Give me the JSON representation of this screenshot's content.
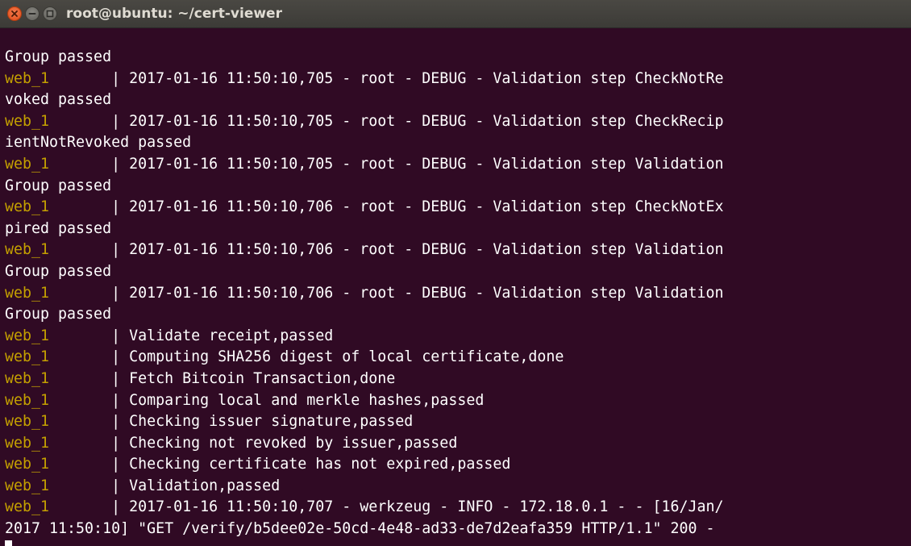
{
  "window": {
    "title": "root@ubuntu: ~/cert-viewer"
  },
  "colors": {
    "background": "#300a24",
    "text": "#ffffff",
    "container_prefix": "#c4a000",
    "close_button": "#df4a16"
  },
  "terminal": {
    "prefix": "web_1       ",
    "lines": [
      {
        "p": false,
        "t": "Group passed"
      },
      {
        "p": true,
        "t": "| 2017-01-16 11:50:10,705 - root - DEBUG - Validation step CheckNotRe"
      },
      {
        "p": false,
        "t": "voked passed"
      },
      {
        "p": true,
        "t": "| 2017-01-16 11:50:10,705 - root - DEBUG - Validation step CheckRecip"
      },
      {
        "p": false,
        "t": "ientNotRevoked passed"
      },
      {
        "p": true,
        "t": "| 2017-01-16 11:50:10,705 - root - DEBUG - Validation step Validation"
      },
      {
        "p": false,
        "t": "Group passed"
      },
      {
        "p": true,
        "t": "| 2017-01-16 11:50:10,706 - root - DEBUG - Validation step CheckNotEx"
      },
      {
        "p": false,
        "t": "pired passed"
      },
      {
        "p": true,
        "t": "| 2017-01-16 11:50:10,706 - root - DEBUG - Validation step Validation"
      },
      {
        "p": false,
        "t": "Group passed"
      },
      {
        "p": true,
        "t": "| 2017-01-16 11:50:10,706 - root - DEBUG - Validation step Validation"
      },
      {
        "p": false,
        "t": "Group passed"
      },
      {
        "p": true,
        "t": "| Validate receipt,passed"
      },
      {
        "p": true,
        "t": "| Computing SHA256 digest of local certificate,done"
      },
      {
        "p": true,
        "t": "| Fetch Bitcoin Transaction,done"
      },
      {
        "p": true,
        "t": "| Comparing local and merkle hashes,passed"
      },
      {
        "p": true,
        "t": "| Checking issuer signature,passed"
      },
      {
        "p": true,
        "t": "| Checking not revoked by issuer,passed"
      },
      {
        "p": true,
        "t": "| Checking certificate has not expired,passed"
      },
      {
        "p": true,
        "t": "| Validation,passed"
      },
      {
        "p": true,
        "t": "| 2017-01-16 11:50:10,707 - werkzeug - INFO - 172.18.0.1 - - [16/Jan/"
      },
      {
        "p": false,
        "t": "2017 11:50:10] \"GET /verify/b5dee02e-50cd-4e48-ad33-de7d2eafa359 HTTP/1.1\" 200 -"
      }
    ]
  }
}
